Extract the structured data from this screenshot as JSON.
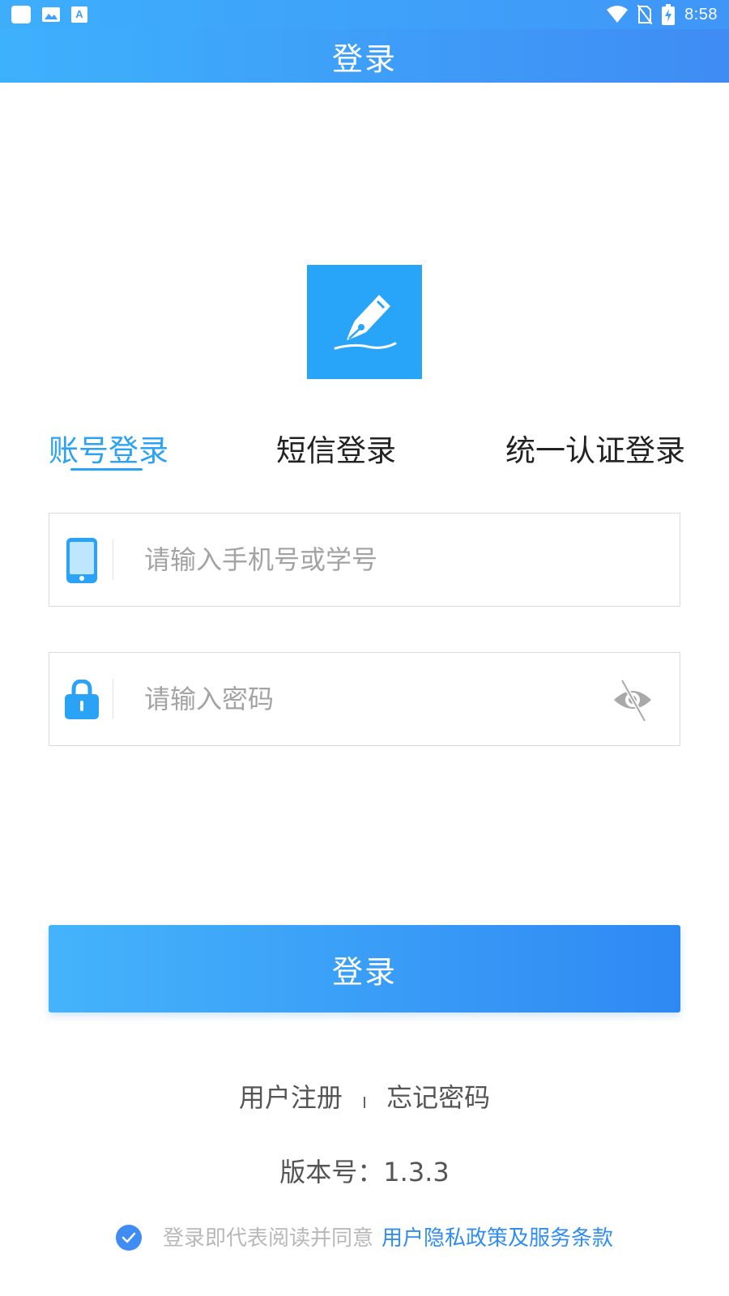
{
  "status_bar": {
    "time": "8:58",
    "left_icons": [
      "app-square-icon",
      "image-icon",
      "font-a-icon"
    ],
    "right_icons": [
      "wifi-icon",
      "no-sim-icon",
      "battery-charging-icon"
    ]
  },
  "header": {
    "title": "登录"
  },
  "logo": {
    "icon": "fountain-pen-icon",
    "color": "#28a4f8"
  },
  "tabs": [
    {
      "label": "账号登录",
      "active": true
    },
    {
      "label": "短信登录",
      "active": false
    },
    {
      "label": "统一认证登录",
      "active": false
    }
  ],
  "form": {
    "account": {
      "icon": "phone-icon",
      "placeholder": "请输入手机号或学号",
      "value": ""
    },
    "password": {
      "icon": "lock-icon",
      "placeholder": "请输入密码",
      "value": "",
      "toggle_icon": "eye-off-icon"
    }
  },
  "login_button": {
    "label": "登录"
  },
  "links": {
    "register": "用户注册",
    "forgot": "忘记密码"
  },
  "version": {
    "text": "版本号：1.3.3"
  },
  "agreement": {
    "checked": true,
    "text": "登录即代表阅读并同意",
    "link": "用户隐私政策及服务条款"
  },
  "colors": {
    "accent": "#2aa2f5",
    "header_start": "#3eb1fc",
    "header_end": "#3f8cf4",
    "link": "#2f8df4"
  }
}
